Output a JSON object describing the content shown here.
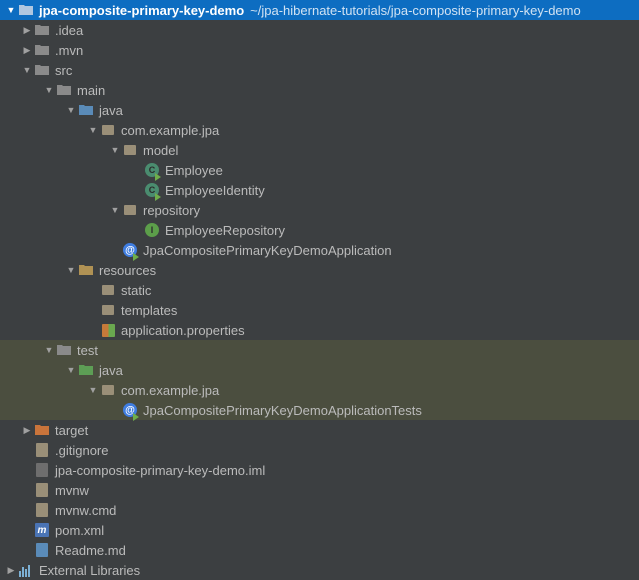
{
  "root": {
    "name": "jpa-composite-primary-key-demo",
    "path": "~/jpa-hibernate-tutorials/jpa-composite-primary-key-demo"
  },
  "tree": {
    "idea": ".idea",
    "mvn": ".mvn",
    "src": "src",
    "main": "main",
    "java": "java",
    "pkg_example": "com.example.jpa",
    "pkg_model": "model",
    "cls_employee": "Employee",
    "cls_employee_identity": "EmployeeIdentity",
    "pkg_repository": "repository",
    "itf_employee_repository": "EmployeeRepository",
    "cls_app": "JpaCompositePrimaryKeyDemoApplication",
    "resources": "resources",
    "static": "static",
    "templates": "templates",
    "app_props": "application.properties",
    "test": "test",
    "test_java": "java",
    "test_pkg": "com.example.jpa",
    "cls_app_tests": "JpaCompositePrimaryKeyDemoApplicationTests",
    "target": "target",
    "gitignore": ".gitignore",
    "iml": "jpa-composite-primary-key-demo.iml",
    "mvnw": "mvnw",
    "mvnw_cmd": "mvnw.cmd",
    "pom": "pom.xml",
    "readme": "Readme.md"
  },
  "external_libraries": "External Libraries"
}
